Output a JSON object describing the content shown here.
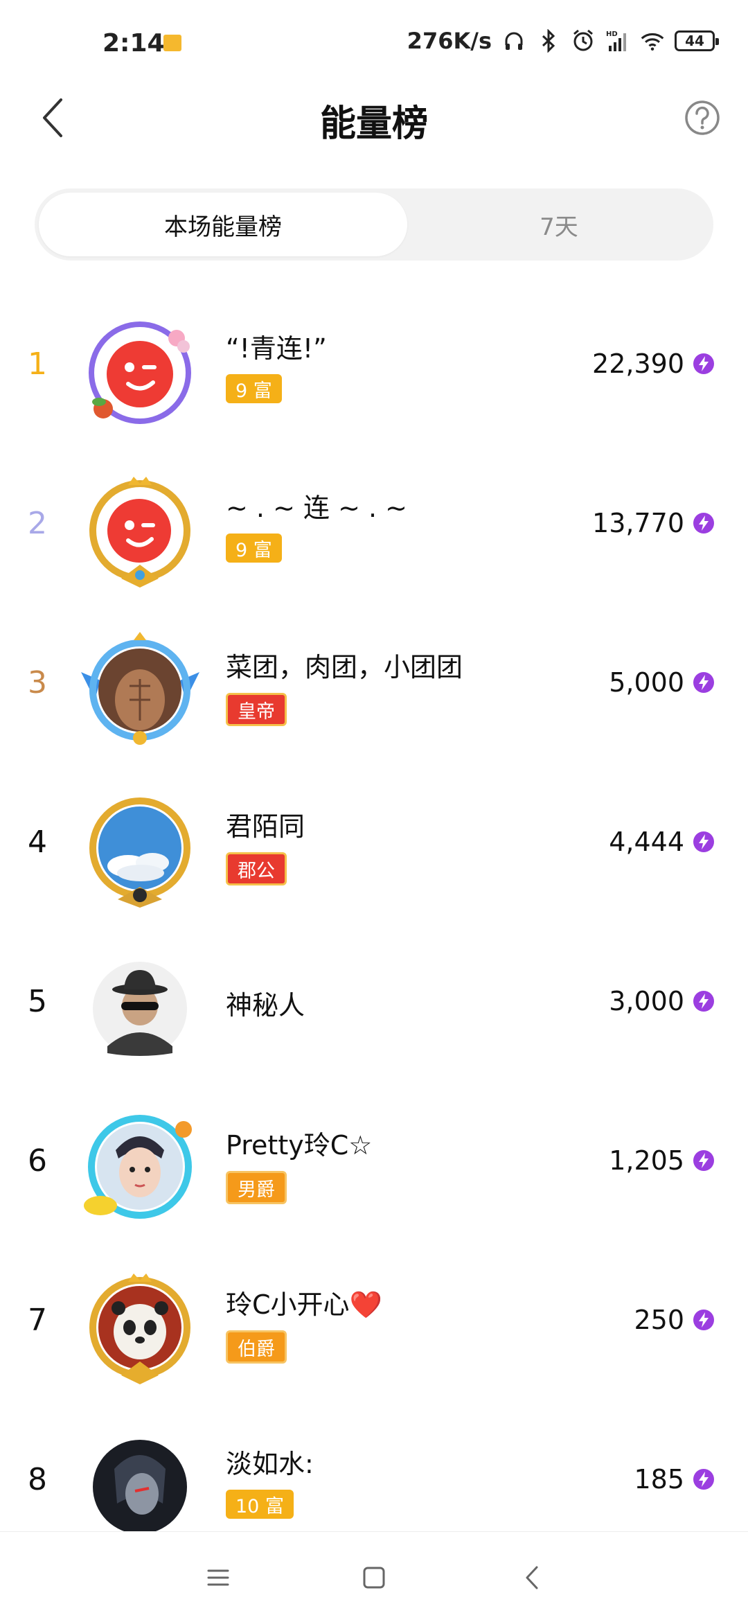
{
  "status_bar": {
    "time": "2:14",
    "net_speed": "276K/s",
    "battery": "44",
    "icons": [
      "headphones-icon",
      "bluetooth-icon",
      "alarm-icon",
      "signal-icon",
      "wifi-icon",
      "battery-icon"
    ]
  },
  "header": {
    "title": "能量榜",
    "back_icon": "back-chevron-icon",
    "help_icon": "help-circle-icon"
  },
  "tabs": [
    {
      "label": "本场能量榜",
      "active": true
    },
    {
      "label": "7天",
      "active": false
    }
  ],
  "ranking": [
    {
      "rank": "1",
      "name": "“!青连!”",
      "badge": "9 富",
      "score": "22,390",
      "rank_color": "#f5b017"
    },
    {
      "rank": "2",
      "name": "~ . ~ 连 ~ . ~",
      "badge": "9 富",
      "score": "13,770",
      "rank_color": "#a8a8e8"
    },
    {
      "rank": "3",
      "name": "菜团，肉团，小团团",
      "badge": "皇帝",
      "score": "5,000",
      "rank_color": "#c98a4b"
    },
    {
      "rank": "4",
      "name": "君陌同",
      "badge": "郡公",
      "score": "4,444",
      "rank_color": "#111111"
    },
    {
      "rank": "5",
      "name": "神秘人",
      "badge": "",
      "score": "3,000",
      "rank_color": "#111111"
    },
    {
      "rank": "6",
      "name": "Pretty玲C☆",
      "badge": "男爵",
      "score": "1,205",
      "rank_color": "#111111"
    },
    {
      "rank": "7",
      "name": "玲C小开心❤️",
      "badge": "伯爵",
      "score": "250",
      "rank_color": "#111111"
    },
    {
      "rank": "8",
      "name": "淡如水:",
      "badge": "10 富",
      "score": "185",
      "rank_color": "#111111"
    }
  ],
  "energy_icon": "lightning-energy-icon",
  "nav": {
    "menu_icon": "menu-icon",
    "home_icon": "home-square-icon",
    "back_icon": "back-triangle-icon"
  }
}
